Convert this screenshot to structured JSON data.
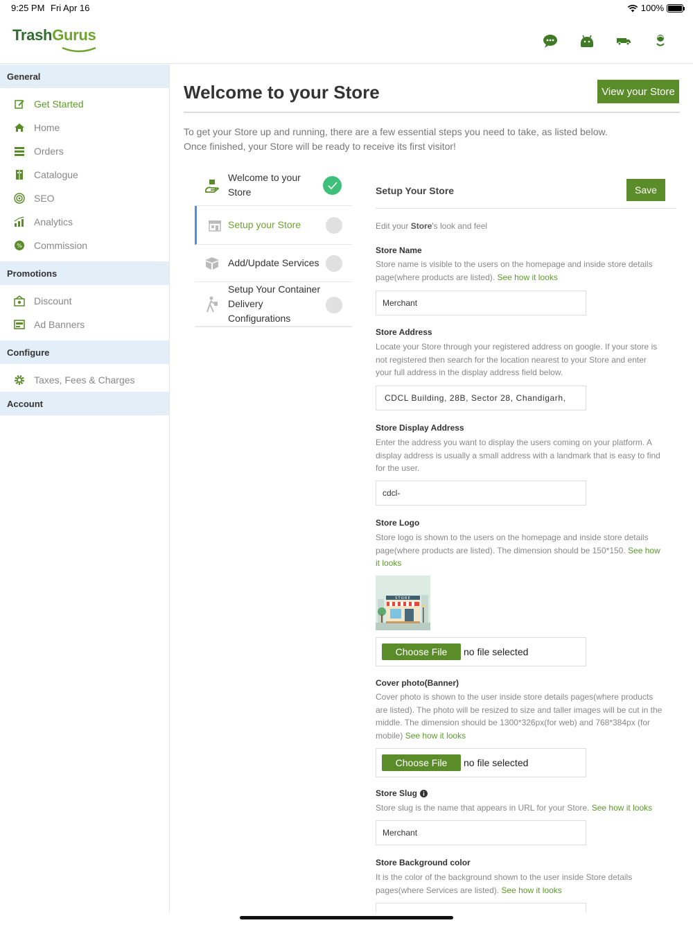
{
  "status_bar": {
    "time": "9:25 PM",
    "date": "Fri Apr 16",
    "battery": "100%"
  },
  "header": {
    "logo_part1": "Trash",
    "logo_part2": "Gurus",
    "icons": [
      "chat-icon",
      "android-icon",
      "delivery-van-icon",
      "user-icon"
    ]
  },
  "sidebar": {
    "sections": [
      {
        "title": "General",
        "items": [
          {
            "label": "Get Started",
            "icon": "edit-icon",
            "active": true
          },
          {
            "label": "Home",
            "icon": "home-icon"
          },
          {
            "label": "Orders",
            "icon": "orders-icon"
          },
          {
            "label": "Catalogue",
            "icon": "catalogue-icon"
          },
          {
            "label": "SEO",
            "icon": "target-icon"
          },
          {
            "label": "Analytics",
            "icon": "chart-icon"
          },
          {
            "label": "Commission",
            "icon": "percent-icon"
          }
        ]
      },
      {
        "title": "Promotions",
        "items": [
          {
            "label": "Discount",
            "icon": "discount-icon"
          },
          {
            "label": "Ad Banners",
            "icon": "banner-icon"
          }
        ]
      },
      {
        "title": "Configure",
        "items": [
          {
            "label": "Taxes, Fees & Charges",
            "icon": "gear-icon"
          }
        ]
      },
      {
        "title": "Account",
        "items": []
      }
    ]
  },
  "main": {
    "title": "Welcome to your Store",
    "view_store_label": "View your Store",
    "intro_line1": "To get your Store up and running, there are a few essential steps you need to take, as listed below.",
    "intro_line2": "Once finished, your Store will be ready to receive its first visitor!"
  },
  "steps": [
    {
      "line1": "Welcome to your",
      "line2": "Store",
      "status": "done",
      "icon": "hand-icon"
    },
    {
      "line1": "Setup your Store",
      "status": "active",
      "icon": "store-icon"
    },
    {
      "line1": "Add/Update Services",
      "status": "pending",
      "icon": "box-icon"
    },
    {
      "line1": "Setup Your Container",
      "line2": "Delivery",
      "line3": "Configurations",
      "status": "pending",
      "icon": "delivery-person-icon"
    }
  ],
  "setup": {
    "title": "Setup Your Store",
    "save_label": "Save",
    "subtitle_pre": "Edit your ",
    "subtitle_bold": "Store",
    "subtitle_post": "'s look and feel",
    "see_how": "See how it looks",
    "store_name": {
      "label": "Store Name",
      "help_l1": "Store name is visible to the users on the homepage and inside store details",
      "help_l2": "page(where products are listed).",
      "value": "Merchant"
    },
    "store_address": {
      "label": "Store Address",
      "help_l1": "Locate your Store through your registered address on google. If your store is",
      "help_l2": "not registered then search for the location nearest to your Store and enter",
      "help_l3": "your full address in the display address field below.",
      "value": "CDCL Building, 28B, Sector 28, Chandigarh,"
    },
    "display_address": {
      "label": "Store Display Address",
      "help_l1": "Enter the address you want to display the users coming on your platform. A",
      "help_l2": "display address is usually a small address with a landmark that is easy to find",
      "help_l3": "for the user.",
      "value": "cdcl-"
    },
    "store_logo": {
      "label": "Store Logo",
      "help_l1": "Store logo is shown to the users on the homepage and inside store details",
      "help_l2": "page(where products are listed). The dimension should be 150*150.",
      "link_a": "See how",
      "link_b": "it looks",
      "thumb_text": "STORE",
      "choose_label": "Choose File",
      "file_status": "no file selected"
    },
    "cover_photo": {
      "label": "Cover photo(Banner)",
      "help_l1": "Cover photo is shown to the user inside store details pages(where products",
      "help_l2": "are listed). The photo will be resized to size and taller images will be cut in the",
      "help_l3": "middle. The dimension should be 1300*326px(for web) and 768*384px (for",
      "help_l4": "mobile)",
      "choose_label": "Choose File",
      "file_status": "no file selected"
    },
    "store_slug": {
      "label": "Store Slug",
      "help_l1": "Store slug is the name that appears in URL for your Store.",
      "value": "Merchant"
    },
    "bg_color": {
      "label": "Store Background color",
      "help_l1": "It is the color of the background shown to the user inside Store details",
      "help_l2": "pages(where Services are listed)."
    }
  },
  "colors": {
    "brand_green": "#5b8c2a",
    "link_green": "#5b9a2a",
    "section_bg": "#e3eff8",
    "done_green": "#3ec07a",
    "active_blue": "#4a8ee0"
  }
}
